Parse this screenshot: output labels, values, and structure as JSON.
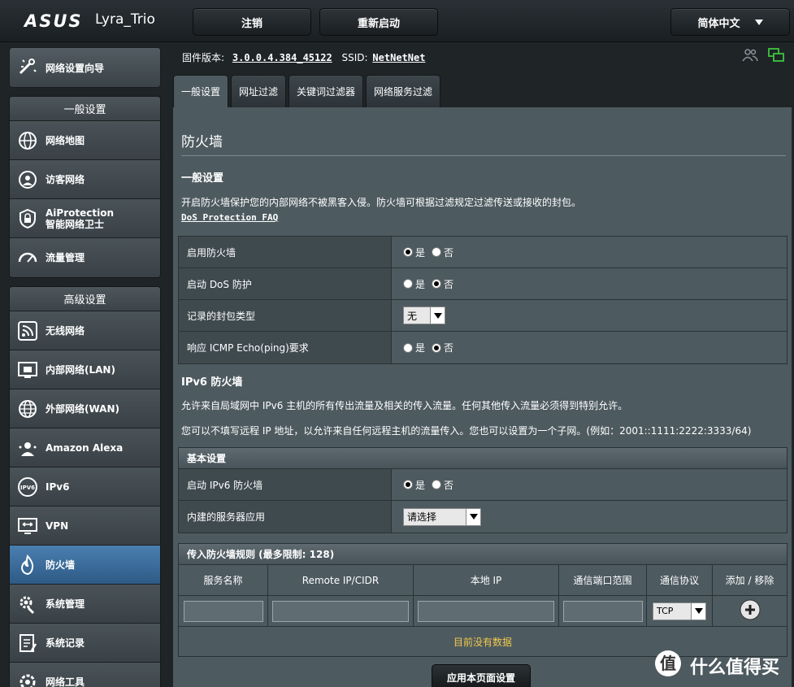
{
  "header": {
    "brand": "ASUS",
    "model": "Lyra_Trio",
    "logout_label": "注销",
    "reboot_label": "重新启动",
    "language_label": "简体中文"
  },
  "sidebar": {
    "wizard_label": "网络设置向导",
    "general_title": "一般设置",
    "general_items": [
      {
        "label": "网络地图",
        "icon": "globe-map-icon"
      },
      {
        "label": "访客网络",
        "icon": "guest-network-icon"
      },
      {
        "label": "AiProtection",
        "label2": "智能网络卫士",
        "icon": "shield-lock-icon"
      },
      {
        "label": "流量管理",
        "icon": "gauge-icon"
      }
    ],
    "advanced_title": "高级设置",
    "advanced_items": [
      {
        "label": "无线网络",
        "icon": "wifi-icon"
      },
      {
        "label": "内部网络(LAN)",
        "icon": "lan-icon"
      },
      {
        "label": "外部网络(WAN)",
        "icon": "wan-globe-icon"
      },
      {
        "label": "Amazon Alexa",
        "icon": "alexa-icon"
      },
      {
        "label": "IPv6",
        "icon": "ipv6-icon"
      },
      {
        "label": "VPN",
        "icon": "vpn-icon"
      },
      {
        "label": "防火墙",
        "icon": "fire-icon"
      },
      {
        "label": "系统管理",
        "icon": "system-gear-icon"
      },
      {
        "label": "系统记录",
        "icon": "log-icon"
      },
      {
        "label": "网络工具",
        "icon": "tools-icon"
      }
    ]
  },
  "status": {
    "firmware_label": "固件版本:",
    "firmware_value": "3.0.0.4.384_45122",
    "ssid_label": "SSID:",
    "ssid_value": "NetNetNet"
  },
  "tabs": [
    "一般设置",
    "网址过滤",
    "关键词过滤器",
    "网络服务过滤"
  ],
  "page": {
    "title": "防火墙",
    "general_heading": "一般设置",
    "general_desc": "开启防火墙保护您的内部网络不被黑客入侵。防火墙可根据过滤规定过滤传送或接收的封包。",
    "dos_faq_link": "DoS Protection FAQ",
    "settings": [
      {
        "label": "启用防火墙",
        "type": "radio",
        "yes": "是",
        "no": "否",
        "value": "yes"
      },
      {
        "label": "启动 DoS 防护",
        "type": "radio",
        "yes": "是",
        "no": "否",
        "value": "no"
      },
      {
        "label": "记录的封包类型",
        "type": "select",
        "value": "无"
      },
      {
        "label": "响应 ICMP Echo(ping)要求",
        "type": "radio",
        "yes": "是",
        "no": "否",
        "value": "no"
      }
    ],
    "ipv6_heading": "IPv6 防火墙",
    "ipv6_desc1": "允许来自局域网中 IPv6 主机的所有传出流量及相关的传入流量。任何其他传入流量必须得到特别允许。",
    "ipv6_desc2": "您可以不填写远程 IP 地址，以允许来自任何远程主机的流量传入。您也可以设置为一个子网。(例如：2001::1111:2222:3333/64)",
    "basic_head": "基本设置",
    "ipv6_settings": [
      {
        "label": "启动 IPv6 防火墙",
        "type": "radio",
        "yes": "是",
        "no": "否",
        "value": "yes"
      },
      {
        "label": "内建的服务器应用",
        "type": "select",
        "value": "请选择"
      }
    ],
    "rules_head": "传入防火墙规则 (最多限制: 128)",
    "rules_columns": [
      "服务名称",
      "Remote IP/CIDR",
      "本地 IP",
      "通信端口范围",
      "通信协议",
      "添加 / 移除"
    ],
    "protocol_value": "TCP",
    "no_data": "目前没有数据",
    "apply_label": "应用本页面设置"
  },
  "watermark": "什么值得买",
  "colors": {
    "panel": "#4d5a60",
    "active_nav": "#2e5a86",
    "no_data_text": "#f2c94c"
  }
}
